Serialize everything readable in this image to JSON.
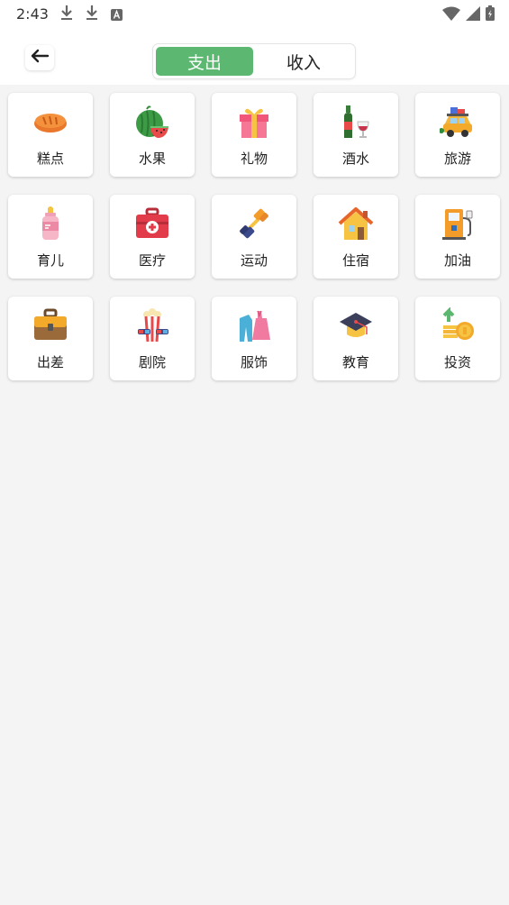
{
  "status": {
    "time": "2:43"
  },
  "header": {
    "tabs": [
      {
        "label": "支出",
        "active": true
      },
      {
        "label": "收入",
        "active": false
      }
    ]
  },
  "categories": [
    {
      "label": "糕点",
      "icon": "bread-icon"
    },
    {
      "label": "水果",
      "icon": "watermelon-icon"
    },
    {
      "label": "礼物",
      "icon": "gift-icon"
    },
    {
      "label": "酒水",
      "icon": "wine-icon"
    },
    {
      "label": "旅游",
      "icon": "car-travel-icon"
    },
    {
      "label": "育儿",
      "icon": "baby-bottle-icon"
    },
    {
      "label": "医疗",
      "icon": "first-aid-kit-icon"
    },
    {
      "label": "运动",
      "icon": "dumbbell-icon"
    },
    {
      "label": "住宿",
      "icon": "house-icon"
    },
    {
      "label": "加油",
      "icon": "fuel-pump-icon"
    },
    {
      "label": "出差",
      "icon": "briefcase-icon"
    },
    {
      "label": "剧院",
      "icon": "popcorn-icon"
    },
    {
      "label": "服饰",
      "icon": "clothes-icon"
    },
    {
      "label": "教育",
      "icon": "graduation-cap-icon"
    },
    {
      "label": "投资",
      "icon": "coins-icon"
    }
  ],
  "colors": {
    "accent": "#5cb870",
    "background": "#f4f4f4"
  }
}
